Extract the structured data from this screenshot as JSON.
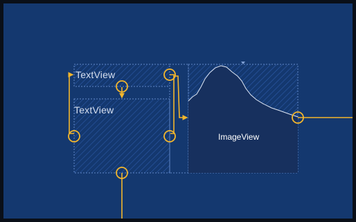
{
  "views": {
    "textview_top": {
      "label": "TextView"
    },
    "textview_bottom": {
      "label": "TextView"
    },
    "imageview": {
      "label": "ImageView"
    }
  },
  "colors": {
    "canvas": "#14386f",
    "view_border": "#5f86c6",
    "hatch": "#2c5aa8",
    "constraint": "#f3b62c",
    "image_fill": "#17305e",
    "image_curve": "#dfe7f5"
  },
  "icons": {
    "anchor": "constraint-anchor-icon",
    "bias_marker": "baseline-marker-icon"
  }
}
